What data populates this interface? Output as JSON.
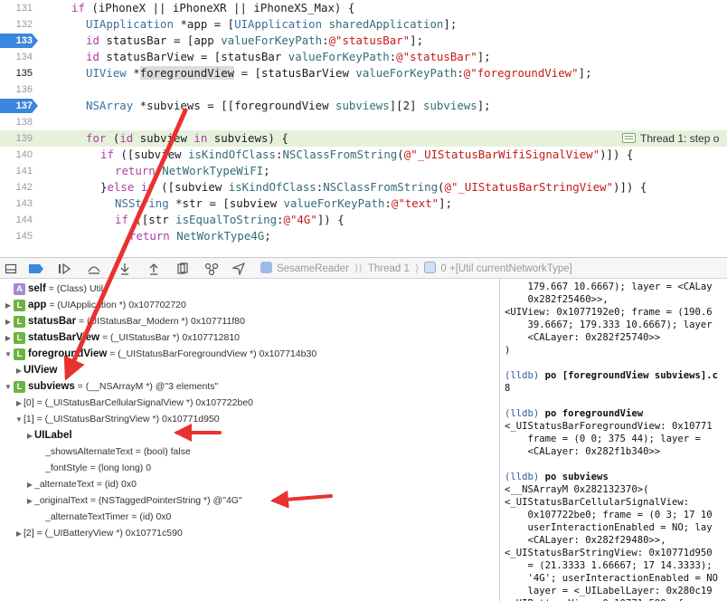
{
  "editor": {
    "lines": [
      {
        "num": "131",
        "indent": 0,
        "html": "<span class='k'>if</span> (iPhoneX || iPhoneXR || iPhoneXS_Max) {"
      },
      {
        "num": "132",
        "indent": 2,
        "html": "<span class='t'>UIApplication</span> *app = [<span class='t'>UIApplication</span> <span class='m'>sharedApplication</span>];"
      },
      {
        "num": "133",
        "indent": 2,
        "bp": true,
        "html": "<span class='k'>id</span> statusBar = [app <span class='m'>valueForKeyPath</span>:<span class='s'>@\"statusBar\"</span>];"
      },
      {
        "num": "134",
        "indent": 2,
        "html": "<span class='k'>id</span> statusBarView = [statusBar <span class='m'>valueForKeyPath</span>:<span class='s'>@\"statusBar\"</span>];"
      },
      {
        "num": "135",
        "indent": 2,
        "cur": true,
        "html": "<span class='t'>UIView</span> *<span class='sel'>foregroundView</span> = [statusBarView <span class='m'>valueForKeyPath</span>:<span class='s'>@\"foregroundView\"</span>];"
      },
      {
        "num": "136",
        "indent": 0,
        "html": ""
      },
      {
        "num": "137",
        "indent": 2,
        "bp": true,
        "html": "<span class='t'>NSArray</span> *subviews = [[foregroundView <span class='m'>subviews</span>][2] <span class='m'>subviews</span>];"
      },
      {
        "num": "138",
        "indent": 0,
        "html": ""
      },
      {
        "num": "139",
        "indent": 2,
        "hl": true,
        "html": "<span class='k'>for</span> (<span class='k'>id</span> subview <span class='k'>in</span> subviews) {"
      },
      {
        "num": "140",
        "indent": 4,
        "html": "<span class='k'>if</span> ([subview <span class='m'>isKindOfClass</span>:<span class='m'>NSClassFromString</span>(<span class='s'>@\"_UIStatusBarWifiSignalView\"</span>)]) {"
      },
      {
        "num": "141",
        "indent": 6,
        "html": "<span class='k'>return</span> <span class='m'>NetWorkTypeWiFI</span>;"
      },
      {
        "num": "142",
        "indent": 4,
        "html": "}<span class='k'>else</span> <span class='k'>if</span> ([subview <span class='m'>isKindOfClass</span>:<span class='m'>NSClassFromString</span>(<span class='s'>@\"_UIStatusBarStringView\"</span>)]) {"
      },
      {
        "num": "143",
        "indent": 6,
        "html": "<span class='t'>NSString</span> *str = [subview <span class='m'>valueForKeyPath</span>:<span class='s'>@\"text\"</span>];"
      },
      {
        "num": "144",
        "indent": 6,
        "html": "<span class='k'>if</span> ([str <span class='m'>isEqualToString</span>:<span class='s'>@\"4G\"</span>]) {"
      },
      {
        "num": "145",
        "indent": 8,
        "html": "<span class='k'>return</span> <span class='m'>NetWorkType4G</span>;"
      }
    ],
    "thread_badge": "Thread 1: step o"
  },
  "debugbar": {
    "crumbs": [
      "SesameReader",
      "Thread 1",
      "0 +[Util currentNetworkType]"
    ]
  },
  "variables": [
    {
      "indent": 0,
      "tri": "",
      "badge": "A",
      "color": "#a58bd6",
      "name": "self",
      "rest": " = (Class) Util"
    },
    {
      "indent": 0,
      "tri": "▶",
      "badge": "L",
      "color": "#6db33f",
      "name": "app",
      "rest": " = (UIApplication *) 0x107702720"
    },
    {
      "indent": 0,
      "tri": "▶",
      "badge": "L",
      "color": "#6db33f",
      "name": "statusBar",
      "rest": " = (UIStatusBar_Modern *) 0x107711f80"
    },
    {
      "indent": 0,
      "tri": "▶",
      "badge": "L",
      "color": "#6db33f",
      "name": "statusBarView",
      "rest": " = (_UIStatusBar *) 0x107712810"
    },
    {
      "indent": 0,
      "tri": "▼",
      "badge": "L",
      "color": "#6db33f",
      "name": "foregroundView",
      "rest": " = (_UIStatusBarForegroundView *) 0x107714b30"
    },
    {
      "indent": 1,
      "tri": "▶",
      "badge": "",
      "color": "",
      "name": "UIView",
      "rest": ""
    },
    {
      "indent": 0,
      "tri": "▼",
      "badge": "L",
      "color": "#6db33f",
      "name": "subviews",
      "rest": " = (__NSArrayM *) @\"3 elements\""
    },
    {
      "indent": 1,
      "tri": "▶",
      "badge": "",
      "color": "",
      "name": "",
      "rest": "[0] = (_UIStatusBarCellularSignalView *) 0x107722be0"
    },
    {
      "indent": 1,
      "tri": "▼",
      "badge": "",
      "color": "",
      "name": "",
      "rest": "[1] = (_UIStatusBarStringView *) 0x10771d950"
    },
    {
      "indent": 2,
      "tri": "▶",
      "badge": "",
      "color": "",
      "name": "UILabel",
      "rest": ""
    },
    {
      "indent": 3,
      "tri": "",
      "badge": "",
      "color": "",
      "name": "",
      "rest": "_showsAlternateText = (bool) false"
    },
    {
      "indent": 3,
      "tri": "",
      "badge": "",
      "color": "",
      "name": "",
      "rest": "_fontStyle = (long long) 0"
    },
    {
      "indent": 2,
      "tri": "▶",
      "badge": "",
      "color": "",
      "name": "",
      "rest": "_alternateText = (id) 0x0"
    },
    {
      "indent": 2,
      "tri": "▶",
      "badge": "",
      "color": "",
      "name": "",
      "rest": "_originalText = (NSTaggedPointerString *) @\"4G\""
    },
    {
      "indent": 3,
      "tri": "",
      "badge": "",
      "color": "",
      "name": "",
      "rest": "_alternateTextTimer = (id) 0x0"
    },
    {
      "indent": 1,
      "tri": "▶",
      "badge": "",
      "color": "",
      "name": "",
      "rest": "[2] = (_UIBatteryView *) 0x10771c590"
    }
  ],
  "console": [
    {
      "cls": "",
      "text": "    179.667 10.6667); layer = <CALay"
    },
    {
      "cls": "",
      "text": "    0x282f25460>>,"
    },
    {
      "cls": "",
      "text": "<UIView: 0x1077192e0; frame = (190.6"
    },
    {
      "cls": "",
      "text": "    39.6667; 179.333 10.6667); layer"
    },
    {
      "cls": "",
      "text": "    <CALayer: 0x282f25740>>"
    },
    {
      "cls": "",
      "text": ")"
    },
    {
      "cls": "",
      "text": ""
    },
    {
      "cls": "cmd",
      "text": "(lldb) po [foregroundView subviews].c"
    },
    {
      "cls": "",
      "text": "8"
    },
    {
      "cls": "",
      "text": ""
    },
    {
      "cls": "cmd",
      "text": "(lldb) po foregroundView"
    },
    {
      "cls": "",
      "text": "<_UIStatusBarForegroundView: 0x10771"
    },
    {
      "cls": "",
      "text": "    frame = (0 0; 375 44); layer ="
    },
    {
      "cls": "",
      "text": "    <CALayer: 0x282f1b340>>"
    },
    {
      "cls": "",
      "text": ""
    },
    {
      "cls": "cmd",
      "text": "(lldb) po subviews"
    },
    {
      "cls": "",
      "text": "<__NSArrayM 0x282132370>("
    },
    {
      "cls": "",
      "text": "<_UIStatusBarCellularSignalView:"
    },
    {
      "cls": "",
      "text": "    0x107722be0; frame = (0 3; 17 10"
    },
    {
      "cls": "",
      "text": "    userInteractionEnabled = NO; lay"
    },
    {
      "cls": "",
      "text": "    <CALayer: 0x282f29480>>,"
    },
    {
      "cls": "",
      "text": "<_UIStatusBarStringView: 0x10771d950"
    },
    {
      "cls": "",
      "text": "    = (21.3333 1.66667; 17 14.3333);"
    },
    {
      "cls": "",
      "text": "    '4G'; userInteractionEnabled = NO"
    },
    {
      "cls": "",
      "text": "    layer = <_UILabelLayer: 0x280c19"
    },
    {
      "cls": "",
      "text": "<_UIBatteryView: 0x10771c590; frame"
    }
  ]
}
